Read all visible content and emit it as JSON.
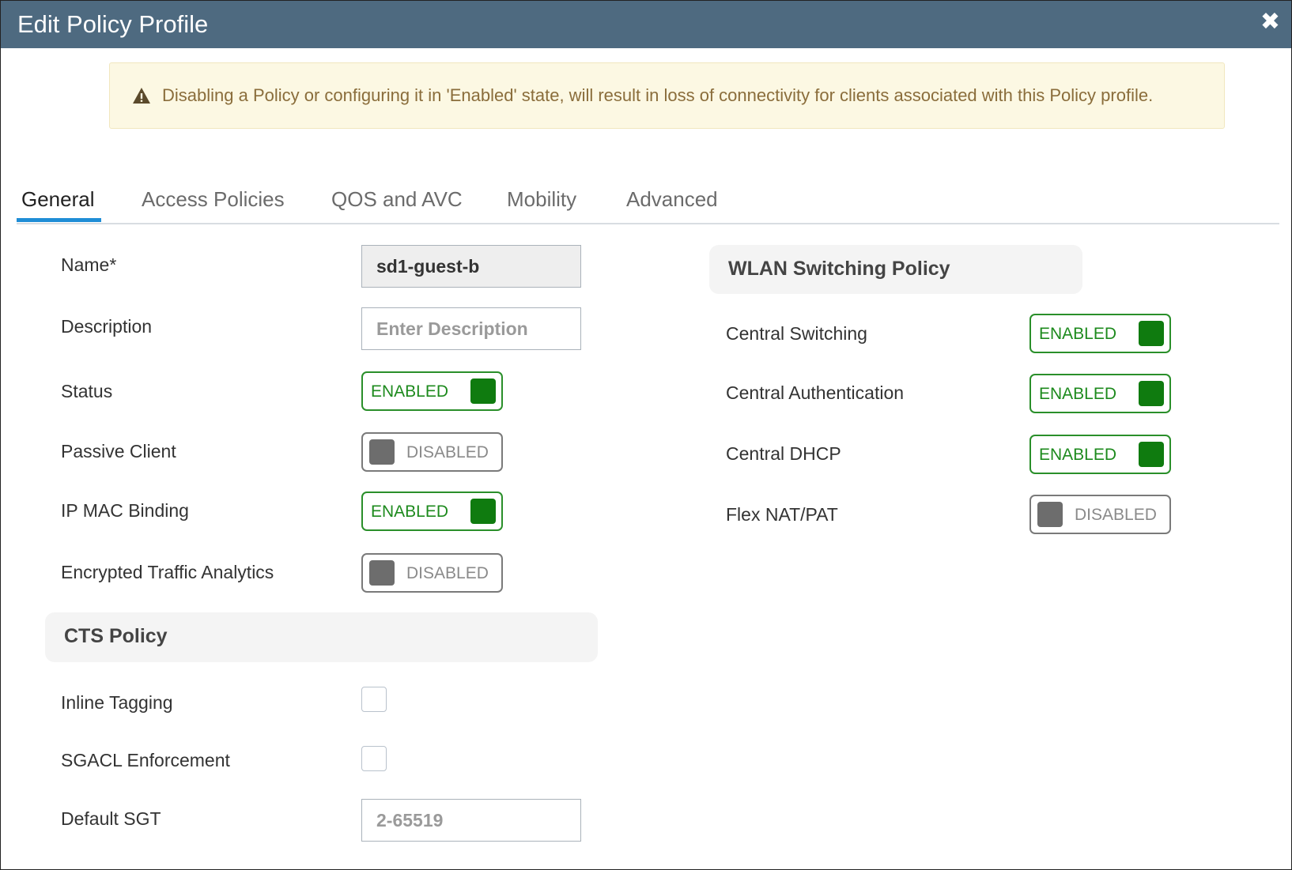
{
  "dialog": {
    "title": "Edit Policy Profile",
    "close_icon": "close-icon"
  },
  "warning": {
    "icon": "warning-triangle-icon",
    "text": "Disabling a Policy or configuring it in 'Enabled' state, will result in loss of connectivity for clients associated with this Policy profile."
  },
  "tabs": [
    {
      "label": "General",
      "active": true
    },
    {
      "label": "Access Policies",
      "active": false
    },
    {
      "label": "QOS and AVC",
      "active": false
    },
    {
      "label": "Mobility",
      "active": false
    },
    {
      "label": "Advanced",
      "active": false
    }
  ],
  "general": {
    "name": {
      "label": "Name*",
      "value": "sd1-guest-b"
    },
    "description": {
      "label": "Description",
      "value": "",
      "placeholder": "Enter Description"
    },
    "status": {
      "label": "Status",
      "state": "ENABLED"
    },
    "passive_client": {
      "label": "Passive Client",
      "state": "DISABLED"
    },
    "ip_mac_binding": {
      "label": "IP MAC Binding",
      "state": "ENABLED"
    },
    "encrypted_traffic_analytics": {
      "label": "Encrypted Traffic Analytics",
      "state": "DISABLED"
    }
  },
  "cts_policy": {
    "title": "CTS Policy",
    "inline_tagging": {
      "label": "Inline Tagging",
      "checked": false
    },
    "sgacl_enforcement": {
      "label": "SGACL Enforcement",
      "checked": false
    },
    "default_sgt": {
      "label": "Default SGT",
      "value": "",
      "placeholder": "2-65519"
    }
  },
  "wlan_switching_policy": {
    "title": "WLAN Switching Policy",
    "central_switching": {
      "label": "Central Switching",
      "state": "ENABLED"
    },
    "central_authentication": {
      "label": "Central Authentication",
      "state": "ENABLED"
    },
    "central_dhcp": {
      "label": "Central DHCP",
      "state": "ENABLED"
    },
    "flex_nat_pat": {
      "label": "Flex NAT/PAT",
      "state": "DISABLED"
    }
  },
  "colors": {
    "title_bar": "#4e6a80",
    "tab_active_underline": "#1f8dd6",
    "toggle_enabled": "#0f7b0f",
    "toggle_disabled": "#6d6d6d",
    "warning_background": "#fcf8e3",
    "warning_text": "#8a6d3b"
  }
}
